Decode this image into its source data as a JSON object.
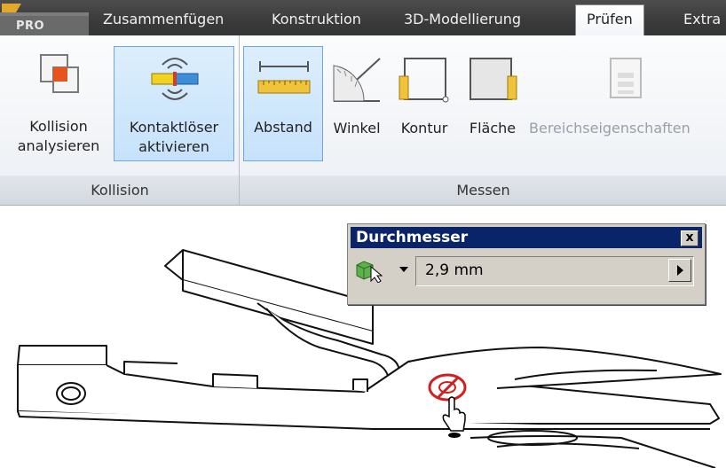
{
  "app": {
    "badge": "PRO"
  },
  "tabs": [
    {
      "label": "Zusammenfügen"
    },
    {
      "label": "Konstruktion"
    },
    {
      "label": "3D-Modellierung"
    },
    {
      "label": "Prüfen",
      "active": true
    },
    {
      "label": "Extra"
    }
  ],
  "ribbon": {
    "kollision": {
      "title": "Kollision",
      "buttons": [
        {
          "line1": "Kollision",
          "line2": "analysieren",
          "icon": "interference-icon"
        },
        {
          "line1": "Kontaktlöser",
          "line2": "aktivieren",
          "icon": "contact-solver-icon",
          "selected": true
        }
      ]
    },
    "messen": {
      "title": "Messen",
      "buttons": [
        {
          "label": "Abstand",
          "icon": "distance-ruler-icon",
          "selected": true
        },
        {
          "label": "Winkel",
          "icon": "angle-icon"
        },
        {
          "label": "Kontur",
          "icon": "loop-icon"
        },
        {
          "label": "Fläche",
          "icon": "area-icon"
        },
        {
          "label": "Bereichseigenschaften",
          "icon": "region-properties-icon",
          "disabled": true
        }
      ]
    }
  },
  "dialog": {
    "title": "Durchmesser",
    "close": "x",
    "value": "2,9 mm",
    "tool_icon": "select-cube-icon"
  },
  "colors": {
    "tab_active_bg": "#ffffff",
    "selected_btn": "#c6e2fb",
    "dialog_title": "#0a246a"
  }
}
